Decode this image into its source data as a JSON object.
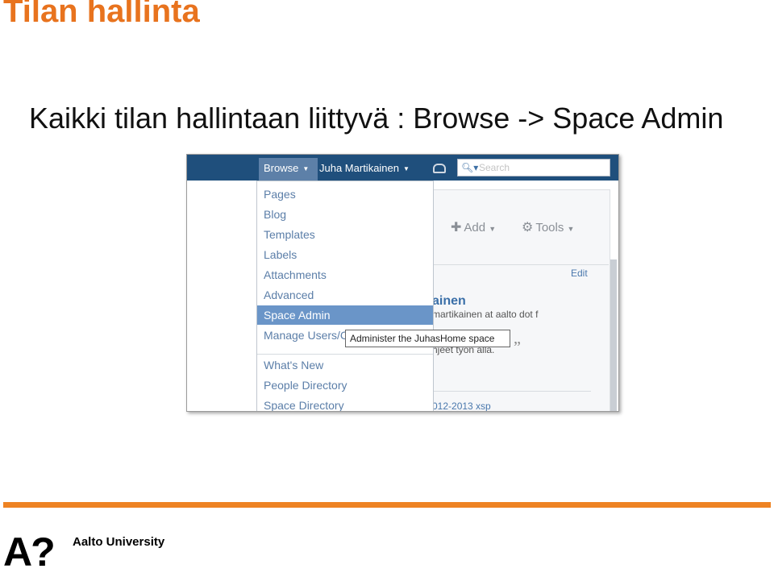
{
  "slide": {
    "title": "Tilan hallinta",
    "bullet": "Kaikki tilan hallintaan liittyvä : Browse -> Space Admin"
  },
  "screenshot": {
    "nav": {
      "browse_label": "Browse",
      "user_label": "Juha Martikainen",
      "search_placeholder": "Search"
    },
    "menu": {
      "items": [
        {
          "label": "Pages"
        },
        {
          "label": "Blog"
        },
        {
          "label": "Templates"
        },
        {
          "label": "Labels"
        },
        {
          "label": "Attachments"
        },
        {
          "label": "Advanced"
        },
        {
          "label": "Space Admin"
        },
        {
          "label": "Manage Users/C"
        },
        {
          "label": "What's New"
        },
        {
          "label": "People Directory"
        },
        {
          "label": "Space Directory"
        }
      ],
      "active_item": "Space Admin"
    },
    "tooltip": "Administer the JuhasHome space",
    "toolbar": {
      "add_label": "Add",
      "tools_label": "Tools",
      "edit_label": "Edit"
    },
    "profile_fragment": {
      "name": "ainen",
      "email": "martikainen at aalto dot f",
      "quote": "hjeet työn alla.",
      "quote_mark": "”",
      "date": "012-2013 xsp"
    },
    "colors": {
      "topbar": "#1f4f7c",
      "menu_highlight": "#6a95c8",
      "accent": "#ee8323"
    }
  },
  "footer": {
    "logo_mark": "A",
    "logo_q": "?",
    "university": "Aalto University"
  }
}
